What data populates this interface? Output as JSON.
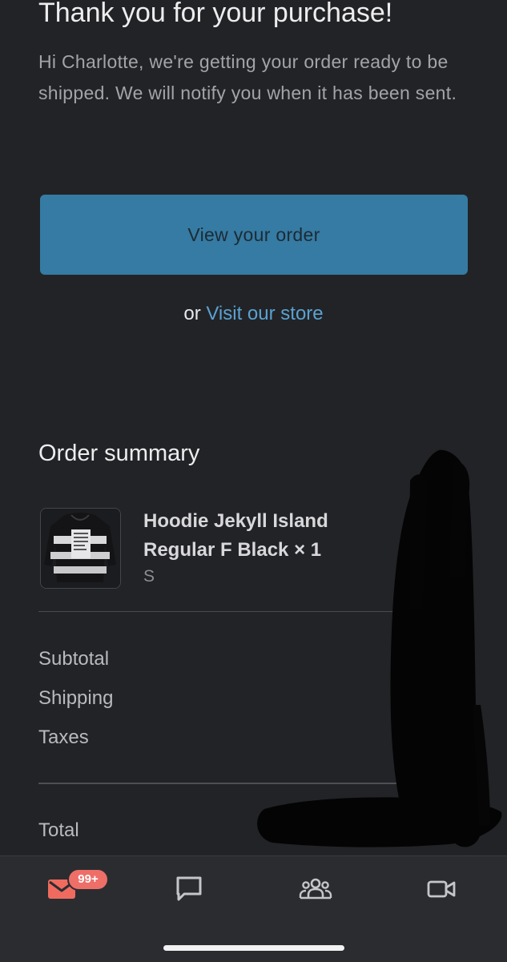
{
  "email": {
    "title": "Thank you for your purchase!",
    "intro": "Hi Charlotte, we're getting your order ready to be shipped. We will notify you when it has been sent.",
    "view_order_label": "View your order",
    "or_text": "or",
    "visit_store_label": "Visit our store"
  },
  "order_summary": {
    "heading": "Order summary",
    "item": {
      "name": "Hoodie Jekyll Island Regular F Black × 1",
      "variant": "S",
      "thumbnail_icon": "hoodie-product-thumbnail"
    },
    "labels": {
      "subtotal": "Subtotal",
      "shipping": "Shipping",
      "taxes": "Taxes",
      "total": "Total"
    }
  },
  "tab_bar": {
    "mail_icon": "mail-icon",
    "mail_badge": "99+",
    "chat_icon": "chat-bubble-icon",
    "people_icon": "people-icon",
    "video_icon": "video-camera-icon"
  },
  "colors": {
    "background": "#222327",
    "button": "#357ba3",
    "link": "#5aa2d0",
    "badge": "#ee6e68",
    "mail_accent": "#ef6b5f"
  }
}
